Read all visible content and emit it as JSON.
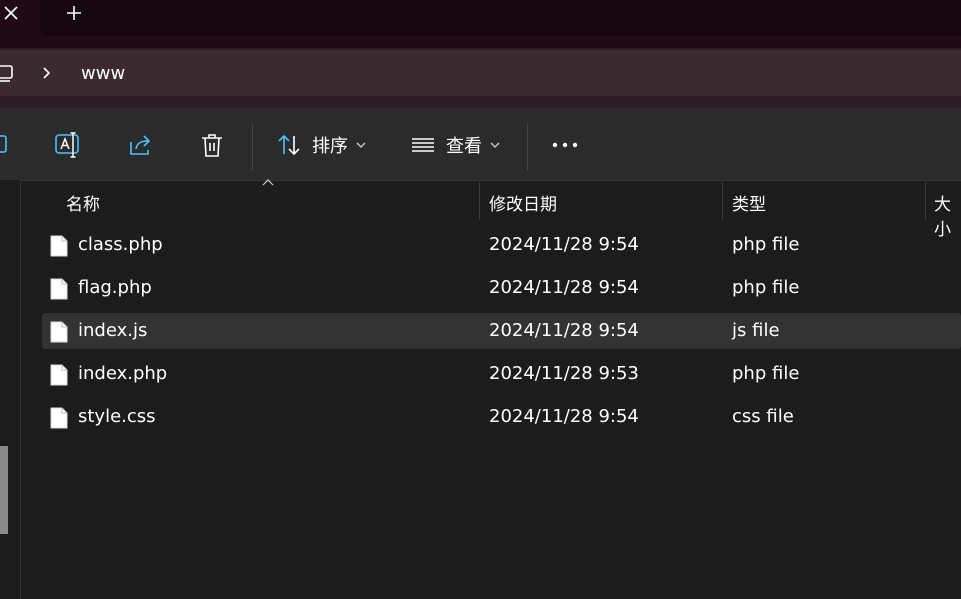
{
  "tabbar": {
    "close_icon": "close-icon",
    "new_tab_label": "+"
  },
  "address": {
    "breadcrumb": [
      "www"
    ]
  },
  "toolbar": {
    "sort_label": "排序",
    "view_label": "查看",
    "icons": [
      "rename-icon",
      "share-icon",
      "delete-icon",
      "sort-icon",
      "view-icon",
      "more-icon"
    ]
  },
  "columns": {
    "name": "名称",
    "modified": "修改日期",
    "type": "类型",
    "size": "大小"
  },
  "files": [
    {
      "name": "class.php",
      "modified": "2024/11/28 9:54",
      "type": "php file"
    },
    {
      "name": "flag.php",
      "modified": "2024/11/28 9:54",
      "type": "php file"
    },
    {
      "name": "index.js",
      "modified": "2024/11/28 9:54",
      "type": "js file",
      "selected": true
    },
    {
      "name": "index.php",
      "modified": "2024/11/28 9:53",
      "type": "php file"
    },
    {
      "name": "style.css",
      "modified": "2024/11/28 9:54",
      "type": "css file"
    }
  ],
  "colors": {
    "accent": "#4cc2ff",
    "background": "#1c1c1c",
    "toolbar": "#2b2b2b",
    "selected_row": "#333333"
  }
}
